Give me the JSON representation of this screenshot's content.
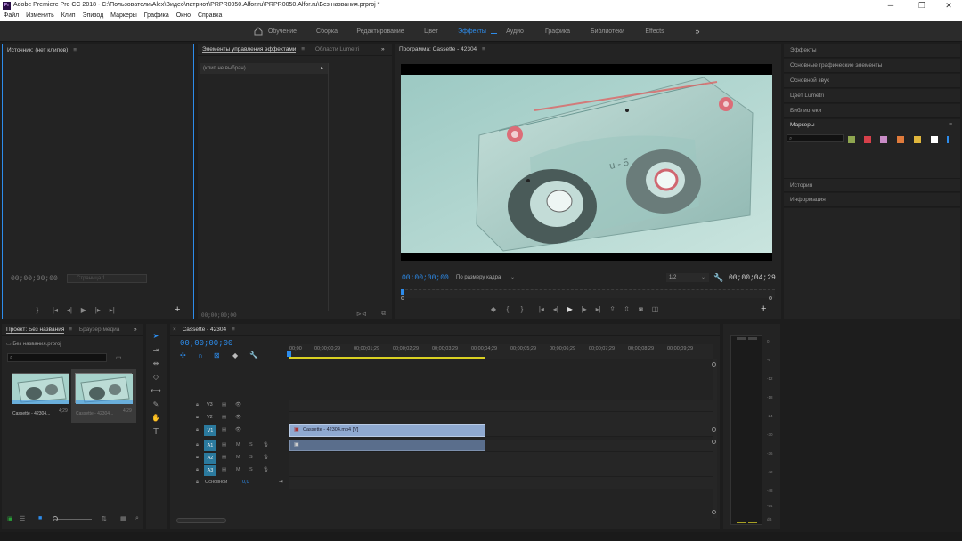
{
  "titlebar": {
    "icon_text": "Pr",
    "title": "Adobe Premiere Pro CC 2018 - C:\\Пользователи\\Alex\\Видео\\патриот\\PRPR0050.Alfor.ru\\PRPR0050.Alfor.ru\\Без названия.prproj *",
    "minimize": "─",
    "maximize": "❐",
    "close": "✕"
  },
  "menu": [
    "Файл",
    "Изменить",
    "Клип",
    "Эпизод",
    "Маркеры",
    "Графика",
    "Окно",
    "Справка"
  ],
  "workspaces": {
    "home_icon": "home-icon",
    "tabs": [
      "Обучение",
      "Сборка",
      "Редактирование",
      "Цвет",
      "Эффекты",
      "Аудио",
      "Графика",
      "Библиотеки",
      "Effects"
    ],
    "active": "Эффекты",
    "more": "»"
  },
  "source": {
    "title": "Источник: (нет клипов)",
    "menu": "≡",
    "timecode": "00;00;00;00",
    "page": "Страница 1",
    "add": "+"
  },
  "effect_controls": {
    "tab": "Элементы управления эффектами",
    "menu": "≡",
    "tab2": "Области Lumetri",
    "more": "»",
    "no_clip": "(клип не выбран)",
    "timecode": "00;00;00;00"
  },
  "program": {
    "title": "Программа: Cassette - 42304",
    "menu": "≡",
    "timecode": "00;00;00;00",
    "fit": "По размеру кадра",
    "res": "1/2",
    "duration": "00;00;04;29",
    "add": "+",
    "playhead_fraction": 0.0
  },
  "right_panel": {
    "items": [
      "Эффекты",
      "Основные графические элементы",
      "Основной звук",
      "Цвет Lumetri",
      "Библиотеки"
    ],
    "markers_title": "Маркеры",
    "markers_menu": "≡",
    "marker_colors": [
      "#8fa650",
      "#d6404a",
      "#c98cc7",
      "#e07b3c",
      "#e0b63c",
      "#ffffff",
      "#2d8ceb"
    ],
    "items2": [
      "История",
      "Информация"
    ]
  },
  "project": {
    "tab": "Проект: Без названия",
    "menu": "≡",
    "tab2": "Браузер медиа",
    "more": "»",
    "file": "Без названия.prproj",
    "clips": [
      {
        "name": "Cassette - 42304...",
        "duration": "4;29"
      },
      {
        "name": "Cassette - 42304...",
        "duration": "4;29"
      }
    ]
  },
  "timeline": {
    "close": "×",
    "tab": "Cassette - 42304",
    "menu": "≡",
    "timecode": "00;00;00;00",
    "ruler": [
      "00;00",
      "00;00;00;29",
      "00;00;01;29",
      "00;00;02;29",
      "00;00;03;29",
      "00;00;04;29",
      "00;00;05;29",
      "00;00;06;29",
      "00;00;07;29",
      "00;00;08;29",
      "00;00;09;29"
    ],
    "video_tracks": [
      "V3",
      "V2",
      "V1"
    ],
    "audio_tracks": [
      "A1",
      "A2",
      "A3"
    ],
    "master": "Основной",
    "master_val": "0,0",
    "clip_label": "Cassette - 42304.mp4 [V]",
    "mute": "M",
    "solo": "S"
  },
  "meter": {
    "ticks": [
      "0",
      "-6",
      "-12",
      "-18",
      "-24",
      "-30",
      "-36",
      "-42",
      "-48",
      "-54",
      "dB"
    ]
  },
  "colors": {
    "accent": "#2d8ceb",
    "video_clip": "#8fa9d0",
    "audio_clip": "#5a6e8c"
  }
}
